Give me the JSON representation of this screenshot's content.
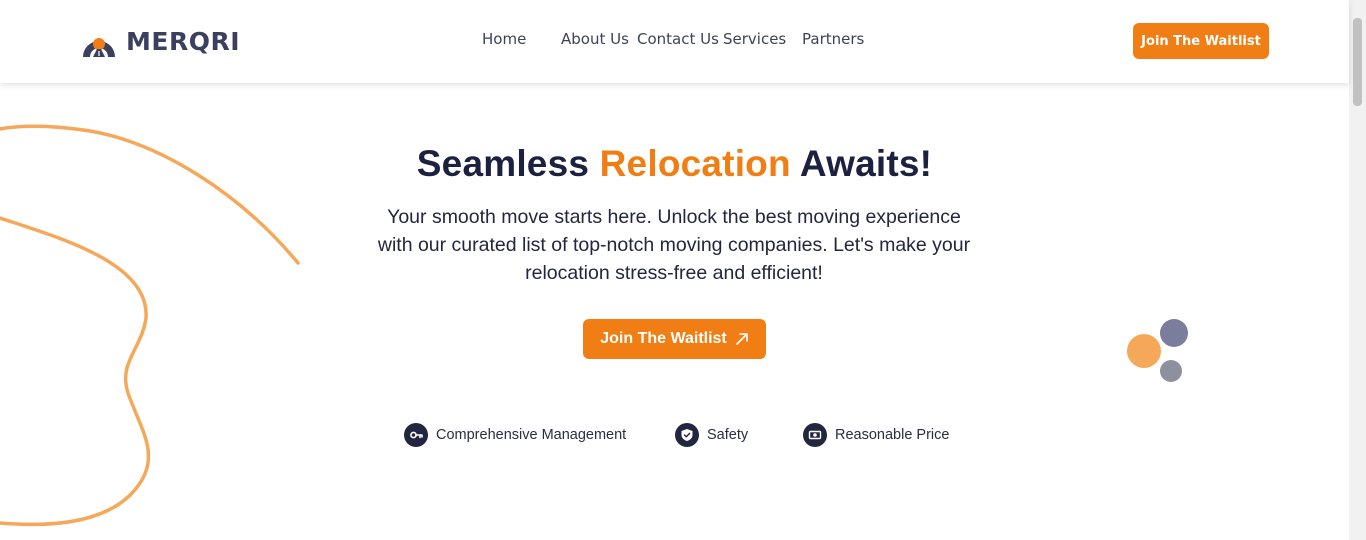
{
  "brand": {
    "name": "MERQRI",
    "accent_color": "#f07e14",
    "text_color": "#3c4060"
  },
  "nav": {
    "items": [
      {
        "label": "Home"
      },
      {
        "label": "About Us"
      },
      {
        "label": "Contact Us"
      },
      {
        "label": "Services"
      },
      {
        "label": "Partners"
      }
    ]
  },
  "header": {
    "cta_label": "Join The Waitlist"
  },
  "hero": {
    "title_part1": "Seamless",
    "title_accent": "Relocation",
    "title_part2": "Awaits!",
    "subtitle": "Your smooth move starts here. Unlock the best moving experience with our curated list of top-notch moving companies. Let's make your relocation stress-free and efficient!",
    "cta_label": "Join The Waitlist",
    "cta_icon": "arrow-up-right-icon"
  },
  "features": [
    {
      "label": "Comprehensive Management",
      "icon": "key-icon"
    },
    {
      "label": "Safety",
      "icon": "shield-icon"
    },
    {
      "label": "Reasonable Price",
      "icon": "money-icon"
    }
  ],
  "colors": {
    "primary": "#f07e14",
    "dark": "#1d2140",
    "decor_orange": "#f5a85a",
    "decor_purple": "#7b7d9c",
    "decor_gray": "#8e909f"
  }
}
